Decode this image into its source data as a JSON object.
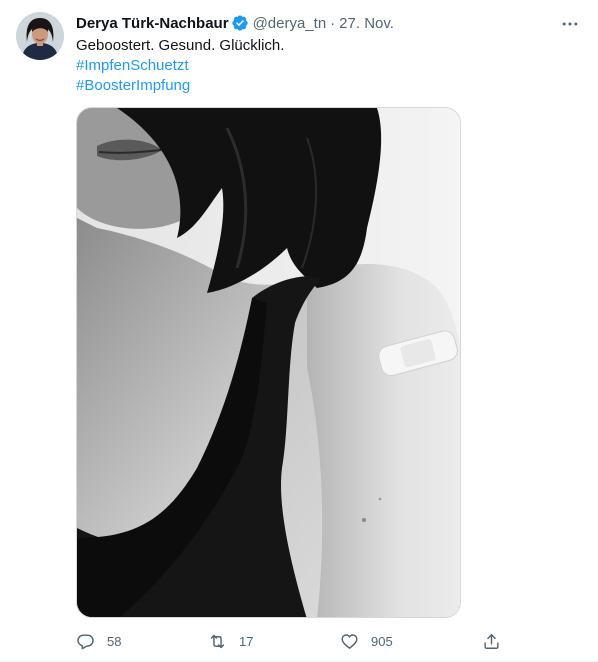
{
  "tweet": {
    "author": {
      "name": "Derya Türk-Nachbaur",
      "handle": "@derya_tn",
      "verified": true,
      "avatar_icon": "profile-photo"
    },
    "separator": "·",
    "date": "27. Nov.",
    "text_lines": [
      "Geboostert. Gesund. Glücklich."
    ],
    "hashtags": [
      "#ImpfenSchuetzt",
      "#BoosterImpfung"
    ],
    "media": {
      "type": "photo",
      "style": "black-and-white"
    },
    "actions": {
      "reply": {
        "icon": "reply-icon",
        "count": "58"
      },
      "retweet": {
        "icon": "retweet-icon",
        "count": "17"
      },
      "like": {
        "icon": "like-icon",
        "count": "905"
      },
      "share": {
        "icon": "share-icon"
      }
    }
  },
  "colors": {
    "text": "#0f1419",
    "secondary": "#536471",
    "accent": "#1d9bf0",
    "border": "#cfd9de"
  }
}
